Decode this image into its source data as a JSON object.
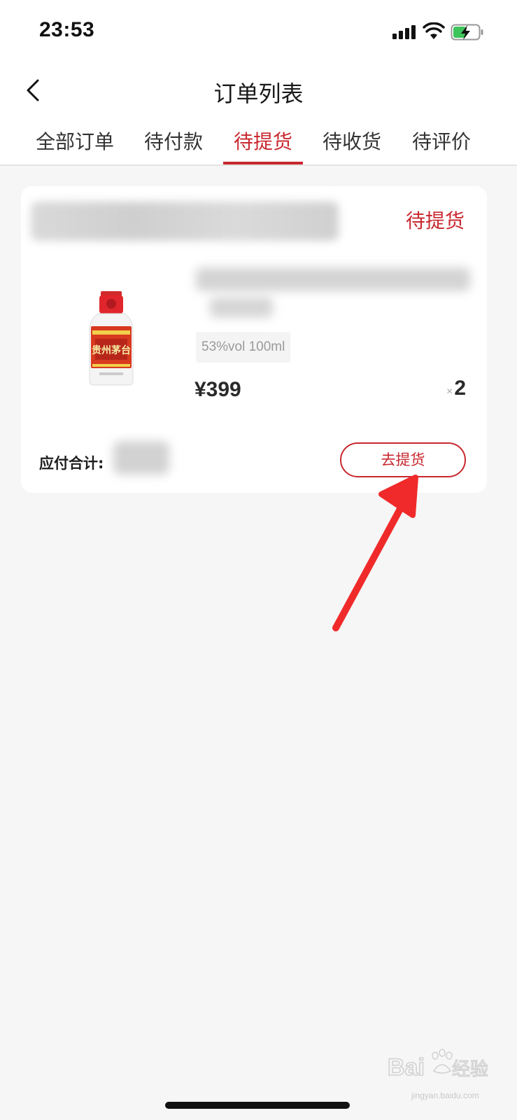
{
  "status_bar": {
    "time": "23:53"
  },
  "nav": {
    "title": "订单列表"
  },
  "tabs": [
    {
      "label": "全部订单",
      "active": false
    },
    {
      "label": "待付款",
      "active": false
    },
    {
      "label": "待提货",
      "active": true
    },
    {
      "label": "待收货",
      "active": false
    },
    {
      "label": "待评价",
      "active": false
    }
  ],
  "order": {
    "status": "待提货",
    "product": {
      "spec": "53%vol 100ml",
      "price": "¥399",
      "quantity_prefix": "×",
      "quantity": "2"
    },
    "total_label": "应付合计:",
    "action_label": "去提货"
  },
  "watermark": {
    "brand": "Bai du 经验",
    "url": "jingyan.baidu.com"
  },
  "colors": {
    "accent": "#c8282f",
    "background": "#f6f6f6",
    "card": "#ffffff",
    "arrow": "#f02a2a"
  }
}
